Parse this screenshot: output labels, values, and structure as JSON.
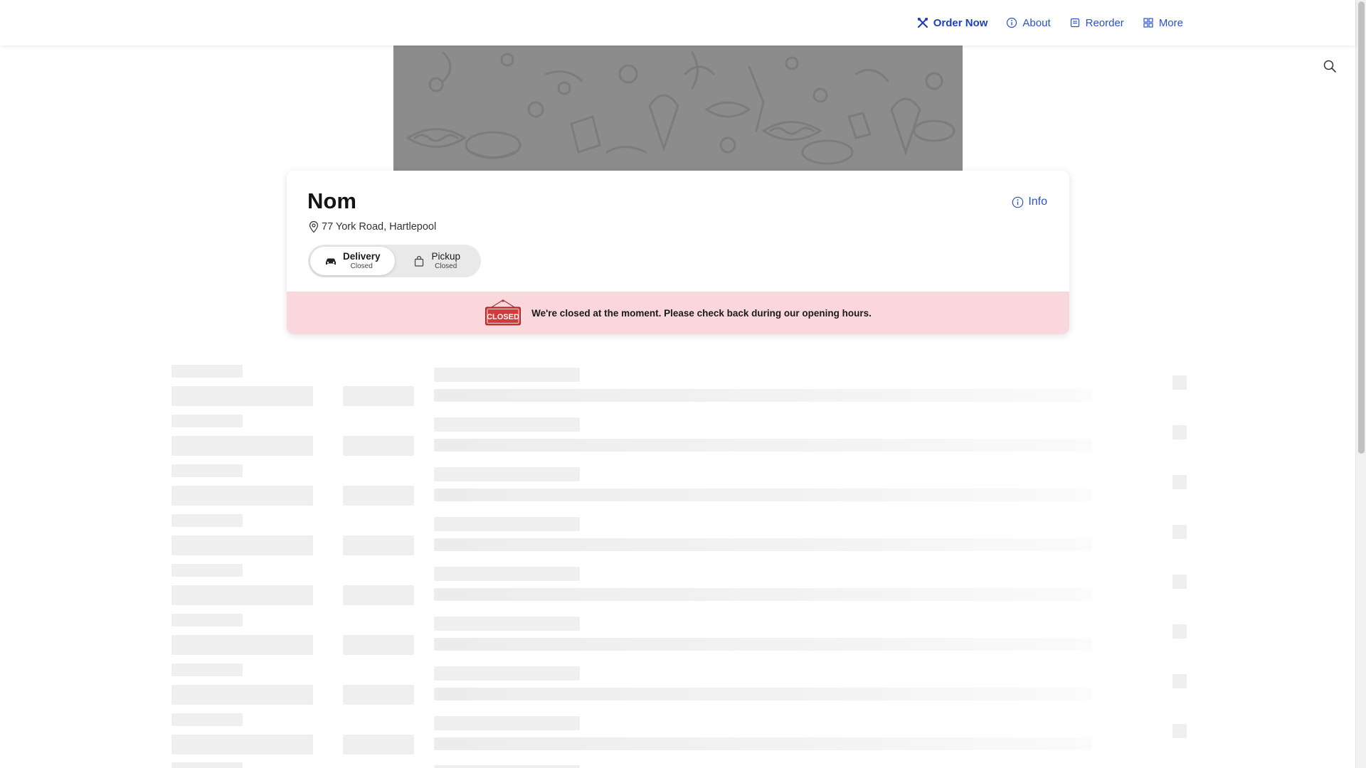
{
  "nav": {
    "items": [
      {
        "label": "Order Now",
        "icon": "utensils-icon",
        "active": true
      },
      {
        "label": "About",
        "icon": "info-circle-icon",
        "active": false
      },
      {
        "label": "Reorder",
        "icon": "receipt-icon",
        "active": false
      },
      {
        "label": "More",
        "icon": "grid-icon",
        "active": false
      }
    ]
  },
  "store": {
    "name": "Nom",
    "address": "77 York Road, Hartlepool",
    "info_label": "Info"
  },
  "modes": [
    {
      "label": "Delivery",
      "status": "Closed",
      "icon": "car-icon",
      "selected": true
    },
    {
      "label": "Pickup",
      "status": "Closed",
      "icon": "bag-icon",
      "selected": false
    }
  ],
  "closed_notice": {
    "sign_text": "CLOSED",
    "message": "We're closed at the moment. Please check back during our opening hours."
  },
  "colors": {
    "accent": "#2a4fd0",
    "closed_banner": "#f9d7dc",
    "closed_sign": "#d33a3a",
    "banner_bg": "#8c8c8c"
  }
}
